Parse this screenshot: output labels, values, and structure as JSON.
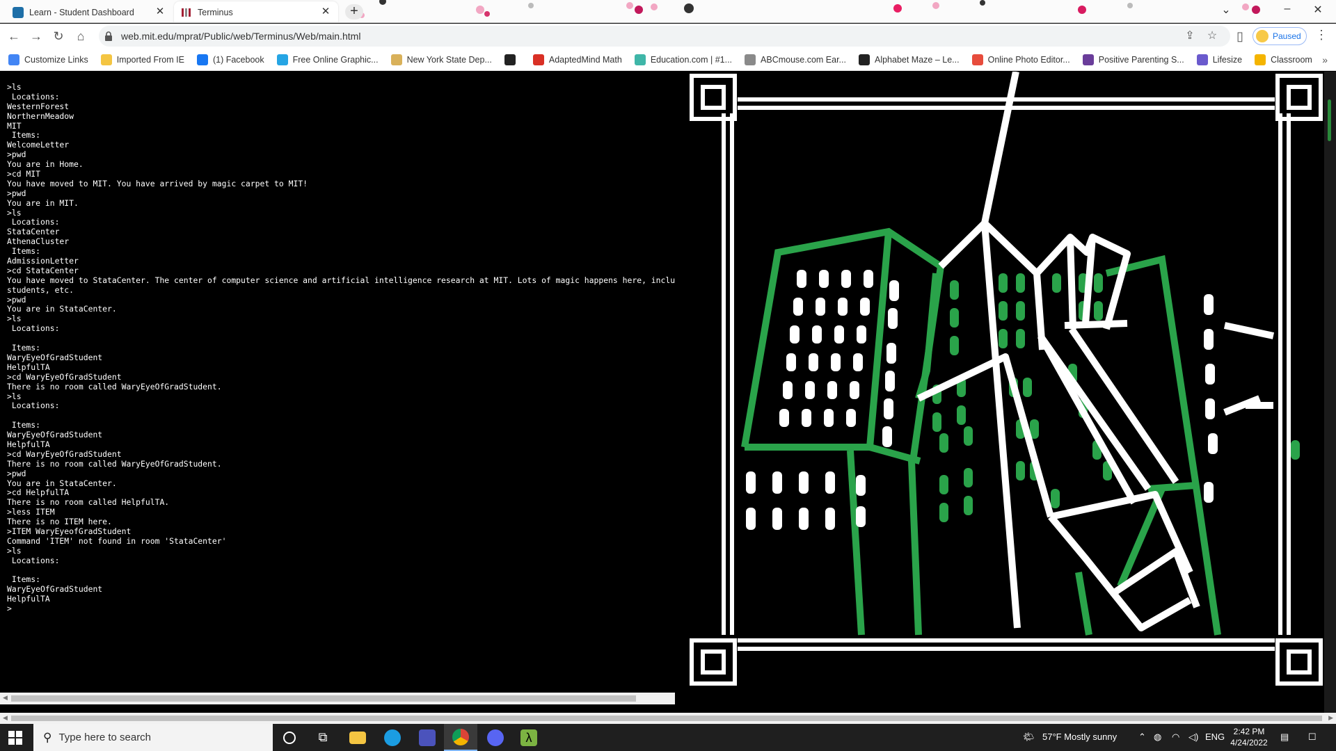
{
  "browser": {
    "tabs": [
      {
        "title": "Learn - Student Dashboard",
        "active": false
      },
      {
        "title": "Terminus",
        "active": true
      }
    ],
    "url": "web.mit.edu/mprat/Public/web/Terminus/Web/main.html",
    "profile_status": "Paused",
    "bookmarks": [
      {
        "label": "Customize Links",
        "color": "#4285f4"
      },
      {
        "label": "Imported From IE",
        "color": "#f4c542"
      },
      {
        "label": "(1) Facebook",
        "color": "#1877f2"
      },
      {
        "label": "Free Online Graphic...",
        "color": "#26a5e4"
      },
      {
        "label": "New York State Dep...",
        "color": "#d9b15a"
      },
      {
        "label": "",
        "color": "#222222"
      },
      {
        "label": "AdaptedMind Math",
        "color": "#d93025"
      },
      {
        "label": "Education.com | #1...",
        "color": "#3fb6a8"
      },
      {
        "label": "ABCmouse.com Ear...",
        "color": "#8a8a8a"
      },
      {
        "label": "Alphabet Maze – Le...",
        "color": "#222222"
      },
      {
        "label": "Online Photo Editor...",
        "color": "#e74c3c"
      },
      {
        "label": "Positive Parenting S...",
        "color": "#6a3d9a"
      },
      {
        "label": "Lifesize",
        "color": "#6a5acd"
      },
      {
        "label": "Classroom",
        "color": "#f4b400"
      }
    ]
  },
  "terminal": {
    "lines": [
      ">ls",
      " Locations:",
      "WesternForest",
      "NorthernMeadow",
      "MIT",
      " Items:",
      "WelcomeLetter",
      ">pwd",
      "You are in Home.",
      ">cd MIT",
      "You have moved to MIT. You have arrived by magic carpet to MIT!",
      ">pwd",
      "You are in MIT.",
      ">ls",
      " Locations:",
      "StataCenter",
      "AthenaCluster",
      " Items:",
      "AdmissionLetter",
      ">cd StataCenter",
      "You have moved to StataCenter. The center of computer science and artificial intelligence research at MIT. Lots of magic happens here, including t",
      "students, etc.",
      ">pwd",
      "You are in StataCenter.",
      ">ls",
      " Locations:",
      "",
      " Items:",
      "WaryEyeOfGradStudent",
      "HelpfulTA",
      ">cd WaryEyeOfGradStudent",
      "There is no room called WaryEyeOfGradStudent.",
      ">ls",
      " Locations:",
      "",
      " Items:",
      "WaryEyeOfGradStudent",
      "HelpfulTA",
      ">cd WaryEyeOfGradStudent",
      "There is no room called WaryEyeOfGradStudent.",
      ">pwd",
      "You are in StataCenter.",
      ">cd HelpfulTA",
      "There is no room called HelpfulTA.",
      ">less ITEM",
      "There is no ITEM here.",
      ">ITEM WaryEyeofGradStudent",
      "Command 'ITEM' not found in room 'StataCenter'",
      ">ls",
      " Locations:",
      "",
      " Items:",
      "WaryEyeOfGradStudent",
      "HelpfulTA",
      ">"
    ]
  },
  "taskbar": {
    "search_placeholder": "Type here to search",
    "weather": "57°F  Mostly sunny",
    "language": "ENG",
    "time": "2:42 PM",
    "date": "4/24/2022"
  },
  "colors": {
    "art_green": "#2aa34a",
    "terminal_text": "#ffffff",
    "accent_blue": "#1a73e8"
  }
}
